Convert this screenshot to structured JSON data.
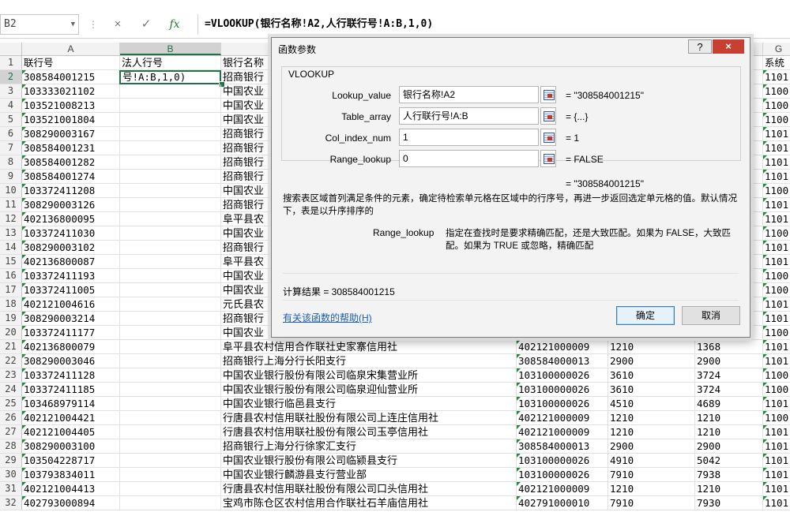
{
  "formula_bar": {
    "cell_ref": "B2",
    "formula": "=VLOOKUP(银行名称!A2,人行联行号!A:B,1,0)",
    "cancel_icon": "×",
    "enter_icon": "✓",
    "fx_icon": "fx"
  },
  "columns": [
    "A",
    "B",
    "C",
    "D",
    "E",
    "F",
    "G"
  ],
  "selected_cell": {
    "column": "B",
    "row": 2,
    "text": "号!A:B,1,0)"
  },
  "rows": [
    {
      "n": "1",
      "a": "联行号",
      "b": "法人行号",
      "c": "银行名称",
      "d": "",
      "e": "",
      "f": "",
      "g": "系统"
    },
    {
      "n": "2",
      "a": "308584001215",
      "b": "",
      "c": "招商银行",
      "d": "",
      "e": "",
      "f": "",
      "g": "1101"
    },
    {
      "n": "3",
      "a": "103333021102",
      "b": "",
      "c": "中国农业",
      "d": "",
      "e": "",
      "f": "",
      "g": "1100"
    },
    {
      "n": "4",
      "a": "103521008213",
      "b": "",
      "c": "中国农业",
      "d": "",
      "e": "",
      "f": "",
      "g": "1100"
    },
    {
      "n": "5",
      "a": "103521001804",
      "b": "",
      "c": "中国农业",
      "d": "",
      "e": "",
      "f": "",
      "g": "1100"
    },
    {
      "n": "6",
      "a": "308290003167",
      "b": "",
      "c": "招商银行",
      "d": "",
      "e": "",
      "f": "",
      "g": "1101"
    },
    {
      "n": "7",
      "a": "308584001231",
      "b": "",
      "c": "招商银行",
      "d": "",
      "e": "",
      "f": "",
      "g": "1101"
    },
    {
      "n": "8",
      "a": "308584001282",
      "b": "",
      "c": "招商银行",
      "d": "",
      "e": "",
      "f": "",
      "g": "1101"
    },
    {
      "n": "9",
      "a": "308584001274",
      "b": "",
      "c": "招商银行",
      "d": "",
      "e": "",
      "f": "",
      "g": "1101"
    },
    {
      "n": "10",
      "a": "103372411208",
      "b": "",
      "c": "中国农业",
      "d": "",
      "e": "",
      "f": "",
      "g": "1100"
    },
    {
      "n": "11",
      "a": "308290003126",
      "b": "",
      "c": "招商银行",
      "d": "",
      "e": "",
      "f": "",
      "g": "1101"
    },
    {
      "n": "12",
      "a": "402136800095",
      "b": "",
      "c": "阜平县农",
      "d": "",
      "e": "",
      "f": "",
      "g": "1101"
    },
    {
      "n": "13",
      "a": "103372411030",
      "b": "",
      "c": "中国农业",
      "d": "",
      "e": "",
      "f": "",
      "g": "1100"
    },
    {
      "n": "14",
      "a": "308290003102",
      "b": "",
      "c": "招商银行",
      "d": "",
      "e": "",
      "f": "",
      "g": "1101"
    },
    {
      "n": "15",
      "a": "402136800087",
      "b": "",
      "c": "阜平县农",
      "d": "",
      "e": "",
      "f": "",
      "g": "1101"
    },
    {
      "n": "16",
      "a": "103372411193",
      "b": "",
      "c": "中国农业",
      "d": "",
      "e": "",
      "f": "",
      "g": "1100"
    },
    {
      "n": "17",
      "a": "103372411005",
      "b": "",
      "c": "中国农业",
      "d": "",
      "e": "",
      "f": "",
      "g": "1100"
    },
    {
      "n": "18",
      "a": "402121004616",
      "b": "",
      "c": "元氏县农",
      "d": "",
      "e": "",
      "f": "",
      "g": "1101"
    },
    {
      "n": "19",
      "a": "308290003214",
      "b": "",
      "c": "招商银行",
      "d": "",
      "e": "",
      "f": "",
      "g": "1101"
    },
    {
      "n": "20",
      "a": "103372411177",
      "b": "",
      "c": "中国农业",
      "d": "",
      "e": "",
      "f": "",
      "g": "1100"
    },
    {
      "n": "21",
      "a": "402136800079",
      "b": "",
      "c": "阜平县农村信用合作联社史家寨信用社",
      "d": "402121000009",
      "e": "1210",
      "f": "1368",
      "g": "1101"
    },
    {
      "n": "22",
      "a": "308290003046",
      "b": "",
      "c": "招商银行上海分行长阳支行",
      "d": "308584000013",
      "e": "2900",
      "f": "2900",
      "g": "1101"
    },
    {
      "n": "23",
      "a": "103372411128",
      "b": "",
      "c": "中国农业银行股份有限公司临泉宋集营业所",
      "d": "103100000026",
      "e": "3610",
      "f": "3724",
      "g": "1100"
    },
    {
      "n": "24",
      "a": "103372411185",
      "b": "",
      "c": "中国农业银行股份有限公司临泉迎仙营业所",
      "d": "103100000026",
      "e": "3610",
      "f": "3724",
      "g": "1100"
    },
    {
      "n": "25",
      "a": "103468979114",
      "b": "",
      "c": "中国农业银行临邑县支行",
      "d": "103100000026",
      "e": "4510",
      "f": "4689",
      "g": "1101"
    },
    {
      "n": "26",
      "a": "402121004421",
      "b": "",
      "c": "行唐县农村信用联社股份有限公司上连庄信用社",
      "d": "402121000009",
      "e": "1210",
      "f": "1210",
      "g": "1100"
    },
    {
      "n": "27",
      "a": "402121004405",
      "b": "",
      "c": "行唐县农村信用联社股份有限公司玉亭信用社",
      "d": "402121000009",
      "e": "1210",
      "f": "1210",
      "g": "1101"
    },
    {
      "n": "28",
      "a": "308290003100",
      "b": "",
      "c": "招商银行上海分行徐家汇支行",
      "d": "308584000013",
      "e": "2900",
      "f": "2900",
      "g": "1101"
    },
    {
      "n": "29",
      "a": "103504228717",
      "b": "",
      "c": "中国农业银行股份有限公司临颍县支行",
      "d": "103100000026",
      "e": "4910",
      "f": "5042",
      "g": "1101"
    },
    {
      "n": "30",
      "a": "103793834011",
      "b": "",
      "c": "中国农业银行麟游县支行营业部",
      "d": "103100000026",
      "e": "7910",
      "f": "7938",
      "g": "1101"
    },
    {
      "n": "31",
      "a": "402121004413",
      "b": "",
      "c": "行唐县农村信用联社股份有限公司口头信用社",
      "d": "402121000009",
      "e": "1210",
      "f": "1210",
      "g": "1101"
    },
    {
      "n": "32",
      "a": "402793000894",
      "b": "",
      "c": "宝鸡市陈仓区农村信用合作联社石羊庙信用社",
      "d": "402791000010",
      "e": "7910",
      "f": "7930",
      "g": "1101"
    }
  ],
  "dialog": {
    "title": "函数参数",
    "help_button": "?",
    "close_button": "×",
    "function_name": "VLOOKUP",
    "params": [
      {
        "label": "Lookup_value",
        "value": "银行名称!A2",
        "result": "=  \"308584001215\""
      },
      {
        "label": "Table_array",
        "value": "人行联行号!A:B",
        "result": "=  {...}"
      },
      {
        "label": "Col_index_num",
        "value": "1",
        "result": "=  1"
      },
      {
        "label": "Range_lookup",
        "value": "0",
        "result": "=  FALSE"
      }
    ],
    "overall_result": "=  \"308584001215\"",
    "description": "搜索表区域首列满足条件的元素，确定待检索单元格在区域中的行序号，再进一步返回选定单元格的值。默认情况下，表是以升序排序的",
    "param_desc_name": "Range_lookup",
    "param_desc": "指定在查找时是要求精确匹配，还是大致匹配。如果为 FALSE，大致匹配。如果为 TRUE 或忽略，精确匹配",
    "calc_result": "计算结果 =    308584001215",
    "help_link": "有关该函数的帮助(H)",
    "ok_button": "确定",
    "cancel_button": "取消"
  }
}
